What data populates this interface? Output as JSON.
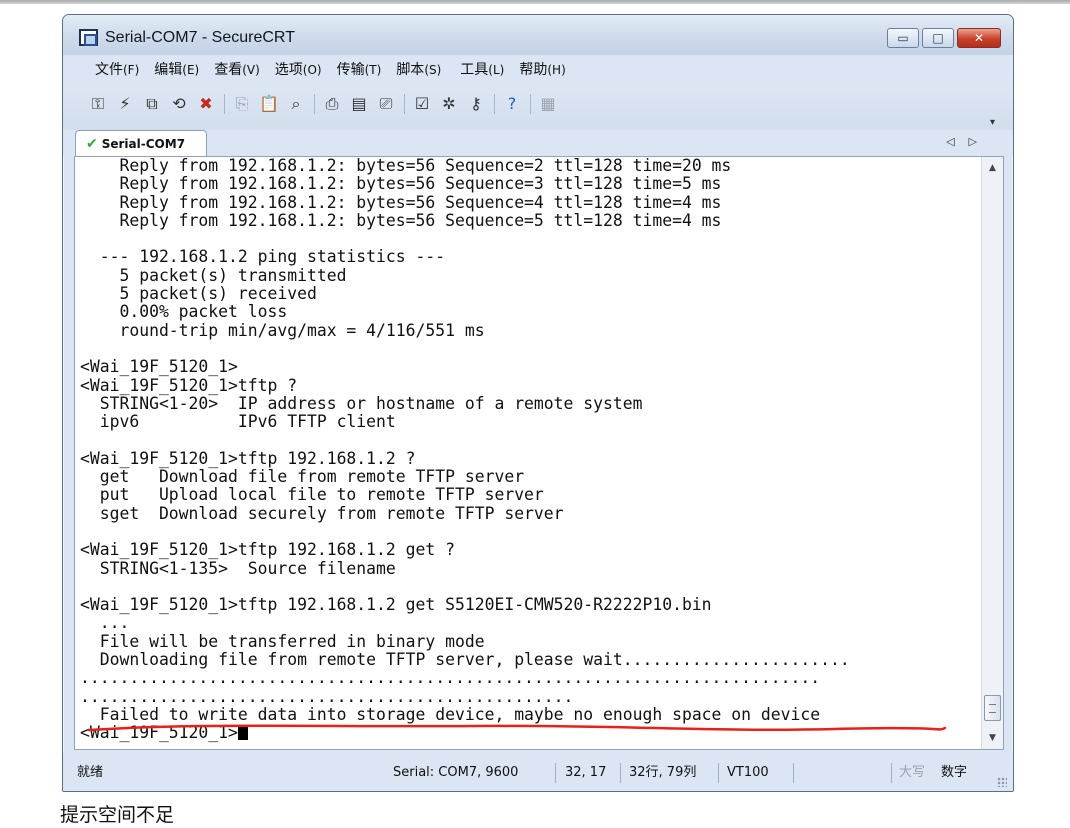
{
  "window": {
    "title": "Serial-COM7 - SecureCRT",
    "controls": {
      "minimize": "▭",
      "maximize": "□",
      "close": "✕"
    }
  },
  "menu": [
    {
      "label": "文件",
      "accel": "(F)"
    },
    {
      "label": "编辑",
      "accel": "(E)"
    },
    {
      "label": "查看",
      "accel": "(V)"
    },
    {
      "label": "选项",
      "accel": "(O)"
    },
    {
      "label": "传输",
      "accel": "(T)"
    },
    {
      "label": "脚本",
      "accel": "(S)"
    },
    {
      "label": "工具",
      "accel": "(L)"
    },
    {
      "label": "帮助",
      "accel": "(H)"
    }
  ],
  "toolbar": {
    "icons": [
      "connect-icon",
      "quick-connect-icon",
      "connect-tab-icon",
      "reconnect-icon",
      "disconnect-icon",
      "copy-icon",
      "paste-icon",
      "find-icon",
      "print-icon",
      "print-screen-icon",
      "print-setup-icon",
      "session-options-icon",
      "global-options-icon",
      "key-icon",
      "help-icon",
      "sftp-icon"
    ]
  },
  "tab": {
    "label": "Serial-COM7",
    "nav_left": "◁",
    "nav_right": "▷"
  },
  "terminal": {
    "lines": [
      "    Reply from 192.168.1.2: bytes=56 Sequence=2 ttl=128 time=20 ms",
      "    Reply from 192.168.1.2: bytes=56 Sequence=3 ttl=128 time=5 ms",
      "    Reply from 192.168.1.2: bytes=56 Sequence=4 ttl=128 time=4 ms",
      "    Reply from 192.168.1.2: bytes=56 Sequence=5 ttl=128 time=4 ms",
      "",
      "  --- 192.168.1.2 ping statistics ---",
      "    5 packet(s) transmitted",
      "    5 packet(s) received",
      "    0.00% packet loss",
      "    round-trip min/avg/max = 4/116/551 ms",
      "",
      "<Wai_19F_5120_1>",
      "<Wai_19F_5120_1>tftp ?",
      "  STRING<1-20>  IP address or hostname of a remote system",
      "  ipv6          IPv6 TFTP client",
      "",
      "<Wai_19F_5120_1>tftp 192.168.1.2 ?",
      "  get   Download file from remote TFTP server",
      "  put   Upload local file to remote TFTP server",
      "  sget  Download securely from remote TFTP server",
      "",
      "<Wai_19F_5120_1>tftp 192.168.1.2 get ?",
      "  STRING<1-135>  Source filename",
      "",
      "<Wai_19F_5120_1>tftp 192.168.1.2 get S5120EI-CMW520-R2222P10.bin",
      "  ...",
      "  File will be transferred in binary mode",
      "  Downloading file from remote TFTP server, please wait.......................",
      "...........................................................................",
      "..................................................",
      "  Failed to write data into storage device, maybe no enough space on device"
    ],
    "prompt": "<Wai_19F_5120_1>"
  },
  "status": {
    "ready": "就绪",
    "connection": "Serial: COM7, 9600",
    "cursor_pos": "32, 17",
    "rows_cols": "32行, 79列",
    "emulation": "VT100",
    "caps": "大写",
    "num": "数字"
  },
  "caption": "提示空间不足",
  "colors": {
    "underline": "#e8201a",
    "window_frame": "#dbe5f3"
  }
}
